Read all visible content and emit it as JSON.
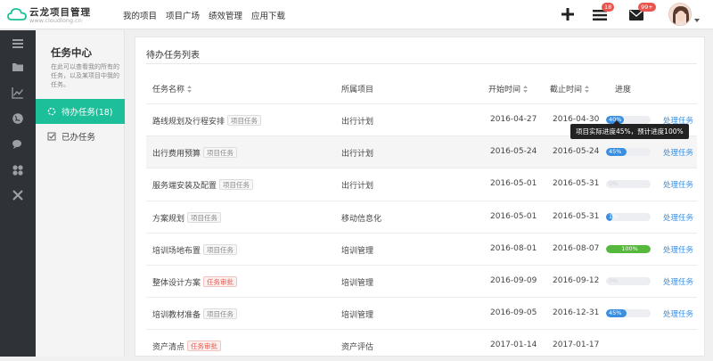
{
  "app": {
    "logo_title": "云龙项目管理",
    "logo_subtitle": "www.cloudlong.cn"
  },
  "nav": [
    "我的项目",
    "项目广场",
    "绩效管理",
    "应用下载"
  ],
  "topbar": {
    "add_icon": "plus-icon",
    "tasks_badge": "18",
    "mail_badge": "99+"
  },
  "sidebar": {
    "title": "任务中心",
    "description": "在此可以查看我的所有的任务，以及某项目中我的任务。",
    "items": [
      {
        "label": "待办任务(18)",
        "icon": "spinner-icon",
        "active": true
      },
      {
        "label": "已办任务",
        "icon": "checkbox-icon",
        "active": false
      }
    ]
  },
  "panel": {
    "title": "待办任务列表",
    "columns": [
      "任务名称",
      "所属项目",
      "开始时间",
      "截止时间",
      "进度"
    ]
  },
  "tasks": [
    {
      "name": "路线规划及行程安排",
      "tag": "项目任务",
      "tag_type": "normal",
      "project": "出行计划",
      "start": "2016-04-27",
      "end": "2016-04-30",
      "progress": 40,
      "progress_label": "40%",
      "color": "#3b8fe0",
      "action": "处理任务"
    },
    {
      "name": "出行费用预算",
      "tag": "项目任务",
      "tag_type": "normal",
      "project": "出行计划",
      "start": "2016-05-24",
      "end": "2016-05-24",
      "progress": 45,
      "progress_label": "45%",
      "color": "#3b8fe0",
      "action": "处理任务"
    },
    {
      "name": "服务端安装及配置",
      "tag": "项目任务",
      "tag_type": "normal",
      "project": "出行计划",
      "start": "2016-05-01",
      "end": "2016-05-31",
      "progress": 0,
      "progress_label": "0%",
      "color": "#3b8fe0",
      "action": "处理任务"
    },
    {
      "name": "方案规划",
      "tag": "项目任务",
      "tag_type": "normal",
      "project": "移动信息化",
      "start": "2016-05-01",
      "end": "2016-05-31",
      "progress": 12,
      "progress_label": "1%",
      "color": "#3b8fe0",
      "action": "处理任务"
    },
    {
      "name": "培训场地布置",
      "tag": "项目任务",
      "tag_type": "normal",
      "project": "培训管理",
      "start": "2016-08-01",
      "end": "2016-08-07",
      "progress": 100,
      "progress_label": "100%",
      "color": "#56b83c",
      "action": "处理任务"
    },
    {
      "name": "整体设计方案",
      "tag": "任务审批",
      "tag_type": "red",
      "project": "培训管理",
      "start": "2016-09-09",
      "end": "2016-09-12",
      "progress": 0,
      "progress_label": "0%",
      "color": "#3b8fe0",
      "action": "处理任务"
    },
    {
      "name": "培训教材准备",
      "tag": "项目任务",
      "tag_type": "normal",
      "project": "培训管理",
      "start": "2016-09-05",
      "end": "2016-12-31",
      "progress": 45,
      "progress_label": "45%",
      "color": "#3b8fe0",
      "action": "处理任务"
    },
    {
      "name": "资产清点",
      "tag": "任务审批",
      "tag_type": "red",
      "project": "资产评估",
      "start": "2017-01-14",
      "end": "2017-01-17",
      "progress": 0,
      "progress_label": "",
      "color": "#3b8fe0",
      "action": ""
    }
  ],
  "tooltip": "项目实际进度45%，预计进度100%"
}
